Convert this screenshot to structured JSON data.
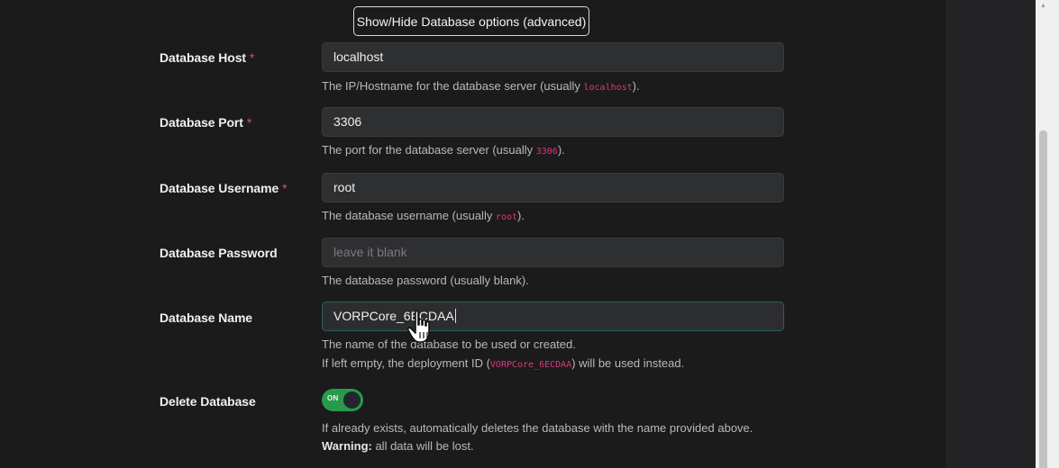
{
  "toolbar": {
    "advanced_toggle_label": "Show/Hide Database options (advanced)"
  },
  "fields": [
    {
      "label": "Database Host",
      "required": "*",
      "value": "localhost",
      "help_before": "The IP/Hostname for the database server (usually ",
      "help_code": "localhost",
      "help_after": ")."
    },
    {
      "label": "Database Port",
      "required": "*",
      "value": "3306",
      "help_before": "The port for the database server (usually ",
      "help_code": "3306",
      "help_after": ")."
    },
    {
      "label": "Database Username",
      "required": "*",
      "value": "root",
      "help_before": "The database username (usually ",
      "help_code": "root",
      "help_after": ")."
    },
    {
      "label": "Database Password",
      "placeholder": "leave it blank",
      "help": "The database password (usually blank)."
    },
    {
      "label": "Database Name",
      "value": "VORPCore_6ECDAA",
      "help_line1": "The name of the database to be used or created.",
      "help_line2_before": "If left empty, the deployment ID (",
      "help_line2_code": "VORPCore_6ECDAA",
      "help_line2_after": ") will be used instead."
    }
  ],
  "delete_db": {
    "label": "Delete Database",
    "toggle_text": "ON",
    "help_line1": "If already exists, automatically deletes the database with the name provided above.",
    "warning_label": "Warning:",
    "warning_text": " all data will be lost."
  },
  "colors": {
    "accent_green": "#279a4c",
    "code_pink": "#e0357c",
    "required_red": "#e05454"
  }
}
